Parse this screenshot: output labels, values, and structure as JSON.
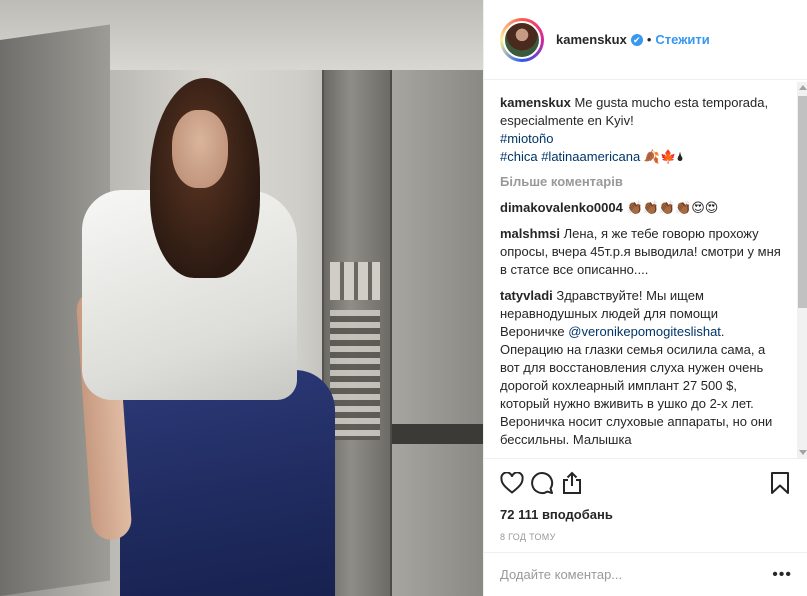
{
  "post": {
    "username": "kamenskux",
    "verified_symbol": "✔",
    "separator": "•",
    "follow_label": "Стежити",
    "caption": {
      "username": "kamenskux",
      "text": " Me gusta mucho esta temporada, especialmente en Kyiv!",
      "hashtag1": "#miotoño",
      "hashtag2": "#chica",
      "hashtag3": "#latinaamericana",
      "emoji": " 🍂🍁🌢"
    },
    "load_more_label": "Більше коментарів",
    "comments": [
      {
        "username": "dimakovalenko0004",
        "text": " 👏🏾👏🏾👏🏾👏🏾😍😍"
      },
      {
        "username": "malshmsi",
        "text": " Лена, я же тебе говорю прохожу опросы, вчера 45т.р.я выводила! смотри у мня в статсе все описанно...."
      },
      {
        "username": "tatyvladi",
        "text_before": " Здравствуйте! Мы ищем неравнодушных людей для помощи Вероничке ",
        "mention": "@veronikepomogiteslishat",
        "text_after": ". Операцию на глазки семья осилила сама, а вот для восстановления слуха нужен очень дорогой кохлеарный имплант 27 500 $, который нужно вживить в ушко до 2-х лет. Вероничка носит слуховые аппараты, но они бессильны. Малышка"
      }
    ],
    "likes": "72 111 вподобань",
    "time_ago": "8 год тому",
    "add_comment_placeholder": "Додайте коментар...",
    "more_options": "•••"
  },
  "icons": [
    "heart-icon",
    "comment-icon",
    "share-icon",
    "bookmark-icon",
    "verified-icon"
  ],
  "colors": {
    "link": "#3897f0",
    "hashtag": "#003569",
    "muted": "#999999",
    "text": "#262626"
  }
}
